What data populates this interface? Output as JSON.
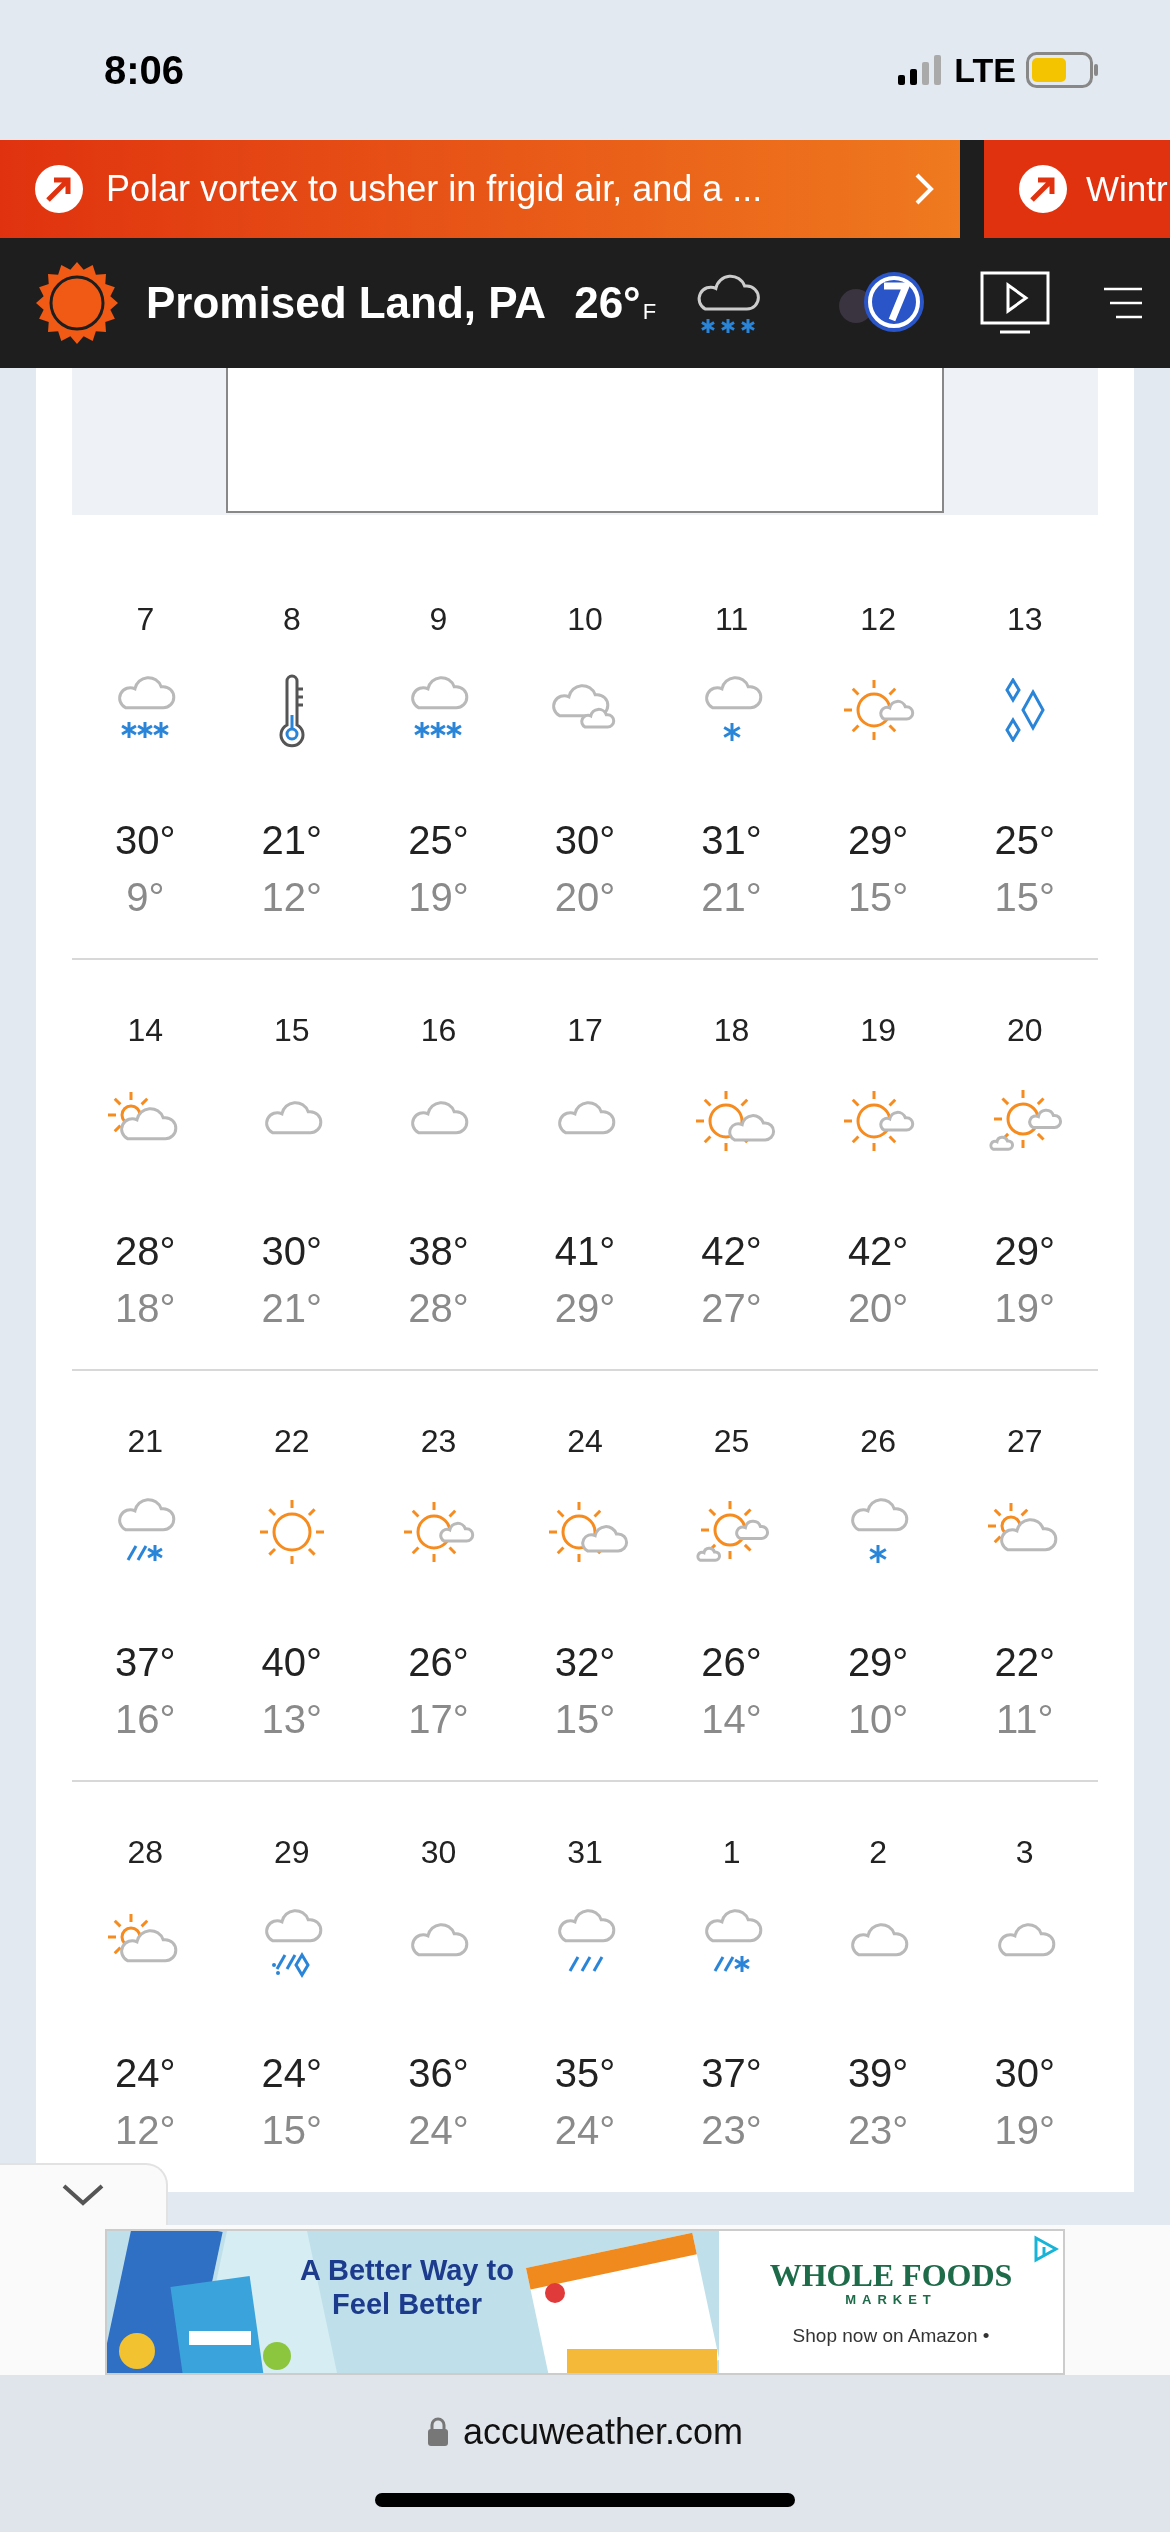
{
  "status_bar": {
    "time": "8:06",
    "network": "LTE"
  },
  "news_banners": [
    {
      "headline": "Polar vortex to usher in frigid air, and a ..."
    },
    {
      "headline": "Wintr"
    }
  ],
  "header": {
    "location": "Promised Land, PA",
    "temperature": "26°",
    "unit": "F"
  },
  "forecast": {
    "weeks": [
      [
        {
          "day": "7",
          "kind": "snow",
          "high": "30°",
          "low": "9°"
        },
        {
          "day": "8",
          "kind": "thermometer",
          "high": "21°",
          "low": "12°"
        },
        {
          "day": "9",
          "kind": "snow",
          "high": "25°",
          "low": "19°"
        },
        {
          "day": "10",
          "kind": "clouds",
          "high": "30°",
          "low": "20°"
        },
        {
          "day": "11",
          "kind": "flurry",
          "high": "31°",
          "low": "21°"
        },
        {
          "day": "12",
          "kind": "sun_cloud",
          "high": "29°",
          "low": "15°"
        },
        {
          "day": "13",
          "kind": "ice",
          "high": "25°",
          "low": "15°"
        }
      ],
      [
        {
          "day": "14",
          "kind": "partly_sunny",
          "high": "28°",
          "low": "18°"
        },
        {
          "day": "15",
          "kind": "cloudy",
          "high": "30°",
          "low": "21°"
        },
        {
          "day": "16",
          "kind": "cloudy",
          "high": "38°",
          "low": "28°"
        },
        {
          "day": "17",
          "kind": "cloudy",
          "high": "41°",
          "low": "29°"
        },
        {
          "day": "18",
          "kind": "intermittent",
          "high": "42°",
          "low": "27°"
        },
        {
          "day": "19",
          "kind": "sun_cloud",
          "high": "42°",
          "low": "20°"
        },
        {
          "day": "20",
          "kind": "sun_clouds",
          "high": "29°",
          "low": "19°"
        }
      ],
      [
        {
          "day": "21",
          "kind": "rain_snow",
          "high": "37°",
          "low": "16°"
        },
        {
          "day": "22",
          "kind": "sun",
          "high": "40°",
          "low": "13°"
        },
        {
          "day": "23",
          "kind": "sun_cloud",
          "high": "26°",
          "low": "17°"
        },
        {
          "day": "24",
          "kind": "intermittent",
          "high": "32°",
          "low": "15°"
        },
        {
          "day": "25",
          "kind": "sun_clouds",
          "high": "26°",
          "low": "14°"
        },
        {
          "day": "26",
          "kind": "flurry",
          "high": "29°",
          "low": "10°"
        },
        {
          "day": "27",
          "kind": "partly_sunny",
          "high": "22°",
          "low": "11°"
        }
      ],
      [
        {
          "day": "28",
          "kind": "partly_sunny",
          "high": "24°",
          "low": "12°"
        },
        {
          "day": "29",
          "kind": "mix",
          "high": "24°",
          "low": "15°"
        },
        {
          "day": "30",
          "kind": "cloudy",
          "high": "36°",
          "low": "24°"
        },
        {
          "day": "31",
          "kind": "rain",
          "high": "35°",
          "low": "24°"
        },
        {
          "day": "1",
          "kind": "rain_snow",
          "high": "37°",
          "low": "23°"
        },
        {
          "day": "2",
          "kind": "cloudy",
          "high": "39°",
          "low": "23°"
        },
        {
          "day": "3",
          "kind": "cloudy",
          "high": "30°",
          "low": "19°"
        }
      ]
    ]
  },
  "ad": {
    "headline": "A Better Way to Feel Better",
    "brand": "WHOLE FOODS",
    "brand_sub": "MARKET",
    "cta": "Shop now on Amazon •"
  },
  "browser": {
    "url": "accuweather.com"
  }
}
